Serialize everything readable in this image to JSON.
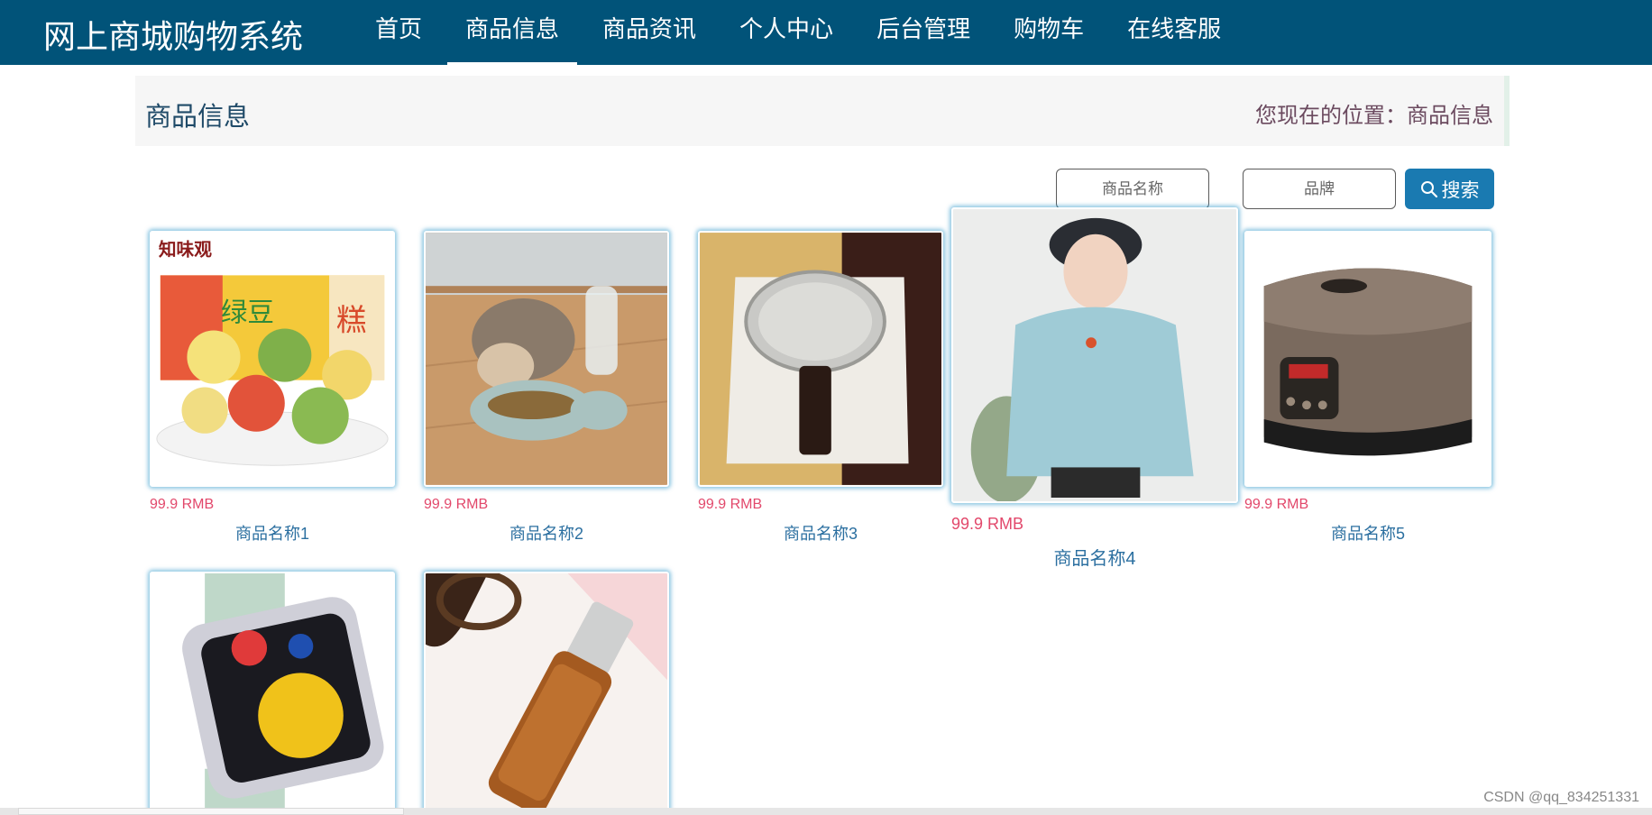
{
  "navbar": {
    "brand": "网上商城购物系统",
    "items": [
      {
        "label": "首页"
      },
      {
        "label": "商品信息"
      },
      {
        "label": "商品资讯"
      },
      {
        "label": "个人中心"
      },
      {
        "label": "后台管理"
      },
      {
        "label": "购物车"
      },
      {
        "label": "在线客服"
      }
    ],
    "active": "商品信息"
  },
  "titlebar": {
    "title": "商品信息",
    "breadcrumb": "您现在的位置：商品信息"
  },
  "search": {
    "name_placeholder": "商品名称",
    "brand_placeholder": "品牌",
    "button_label": "搜索"
  },
  "products": [
    {
      "price": "99.9 RMB",
      "name": "商品名称1",
      "image": "mooncake-gift-box"
    },
    {
      "price": "99.9 RMB",
      "name": "商品名称2",
      "image": "cat-feeder-bowl"
    },
    {
      "price": "99.9 RMB",
      "name": "商品名称3",
      "image": "mirror-device"
    },
    {
      "price": "99.9 RMB",
      "name": "商品名称4",
      "image": "woman-blue-hoodie"
    },
    {
      "price": "99.9 RMB",
      "name": "商品名称5",
      "image": "rice-cooker"
    },
    {
      "price": "",
      "name": "",
      "image": "smartwatch"
    },
    {
      "price": "",
      "name": "",
      "image": "serum-bottle"
    }
  ],
  "watermark": "CSDN @qq_834251331",
  "colors": {
    "nav_bg": "#015379",
    "accent": "#1a7ab1",
    "price": "#e2486b",
    "product_name": "#2b6fa0"
  }
}
